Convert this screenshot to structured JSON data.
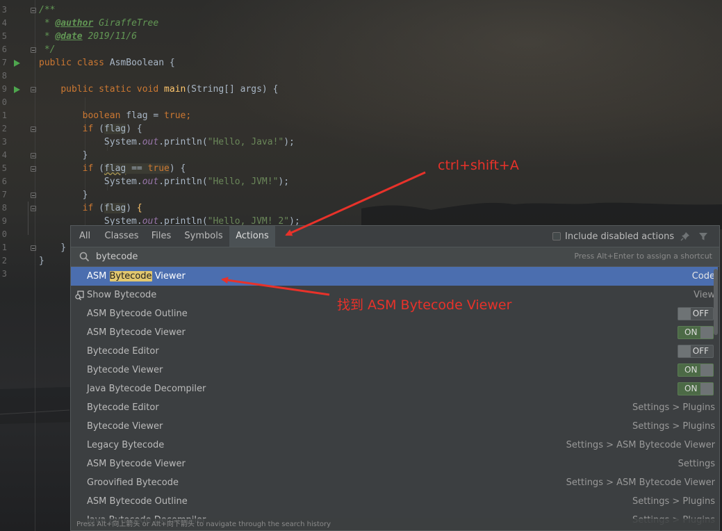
{
  "editor": {
    "line_numbers": [
      "3",
      "4",
      "5",
      "6",
      "7",
      "8",
      "9",
      "0",
      "1",
      "2",
      "3",
      "4",
      "5",
      "6",
      "7",
      "8",
      "9",
      "0",
      "1",
      "2",
      "3"
    ],
    "comment": {
      "open": "/**",
      "author_prefix": " * ",
      "author_tag": "@author",
      "author_value": " GiraffeTree",
      "date_prefix": " * ",
      "date_tag": "@date",
      "date_value": " 2019/11/6",
      "close": " */"
    },
    "class_line": {
      "kw1": "public",
      "kw2": "class",
      "name": " AsmBoolean {"
    },
    "main_line": {
      "indent": "    ",
      "kw1": "public",
      "kw2": "static",
      "kw3": "void",
      "fn": "main",
      "rest": "(String[] args) {"
    },
    "decl_line": {
      "indent": "        ",
      "kw": "boolean",
      "mid": " flag = ",
      "val": "true",
      "end": ";"
    },
    "if1": {
      "indent": "        ",
      "kw": "if",
      "open": " (",
      "var": "flag",
      "close": ") {"
    },
    "print1": {
      "indent": "            ",
      "obj": "System.",
      "fld": "out",
      "call": ".println(",
      "str": "\"Hello, Java!\"",
      "end": ");"
    },
    "brace1": "        }",
    "if2": {
      "indent": "        ",
      "kw": "if",
      "open": " (",
      "var": "flag",
      "op": " == ",
      "val": "true",
      "close": ") {"
    },
    "print2": {
      "indent": "            ",
      "obj": "System.",
      "fld": "out",
      "call": ".println(",
      "str": "\"Hello, JVM!\"",
      "end": ");"
    },
    "brace2": "        }",
    "if3": {
      "indent": "        ",
      "kw": "if",
      "open": " (",
      "var": "flag",
      "close": ") ",
      "brace": "{"
    },
    "print3": {
      "indent": "            ",
      "obj": "System.",
      "fld": "out",
      "call": ".println(",
      "str": "\"Hello, JVM! 2\"",
      "end": ");"
    },
    "brace_method": "    }",
    "brace_class": "}"
  },
  "popup": {
    "tabs": [
      "All",
      "Classes",
      "Files",
      "Symbols",
      "Actions"
    ],
    "active_tab": "Actions",
    "include_disabled_label": "Include disabled actions",
    "include_disabled_checked": false,
    "search": {
      "value": "bytecode",
      "hint": "Press Alt+Enter to assign a shortcut"
    },
    "results": [
      {
        "pre": "ASM ",
        "match": "Bytecode",
        "post": " Viewer",
        "right": "Code",
        "selected": true
      },
      {
        "pre": "Show Bytecode",
        "match": "",
        "post": "",
        "right": "View",
        "icon": "bytecode-view-icon"
      },
      {
        "pre": "ASM Bytecode Outline",
        "match": "",
        "post": "",
        "toggle": "OFF"
      },
      {
        "pre": "ASM Bytecode Viewer",
        "match": "",
        "post": "",
        "toggle": "ON"
      },
      {
        "pre": "Bytecode Editor",
        "match": "",
        "post": "",
        "toggle": "OFF"
      },
      {
        "pre": "Bytecode Viewer",
        "match": "",
        "post": "",
        "toggle": "ON"
      },
      {
        "pre": "Java Bytecode Decompiler",
        "match": "",
        "post": "",
        "toggle": "ON"
      },
      {
        "pre": "Bytecode Editor",
        "match": "",
        "post": "",
        "right": "Settings > Plugins"
      },
      {
        "pre": "Bytecode Viewer",
        "match": "",
        "post": "",
        "right": "Settings > Plugins"
      },
      {
        "pre": "Legacy Bytecode",
        "match": "",
        "post": "",
        "right": "Settings > ASM Bytecode Viewer"
      },
      {
        "pre": "ASM Bytecode Viewer",
        "match": "",
        "post": "",
        "right": "Settings"
      },
      {
        "pre": "Groovified Bytecode",
        "match": "",
        "post": "",
        "right": "Settings > ASM Bytecode Viewer"
      },
      {
        "pre": "ASM Bytecode Outline",
        "match": "",
        "post": "",
        "right": "Settings > Plugins"
      },
      {
        "pre": "Java Bytecode Decompiler",
        "match": "",
        "post": "",
        "right": "Settings > Plugins"
      }
    ],
    "footer": "Press Alt+向上箭头 or Alt+向下箭头 to navigate through the search history"
  },
  "annotations": {
    "shortcut": "ctrl+shift+A",
    "found": "找到 ASM Bytecode Viewer",
    "color": "#e8322a"
  }
}
